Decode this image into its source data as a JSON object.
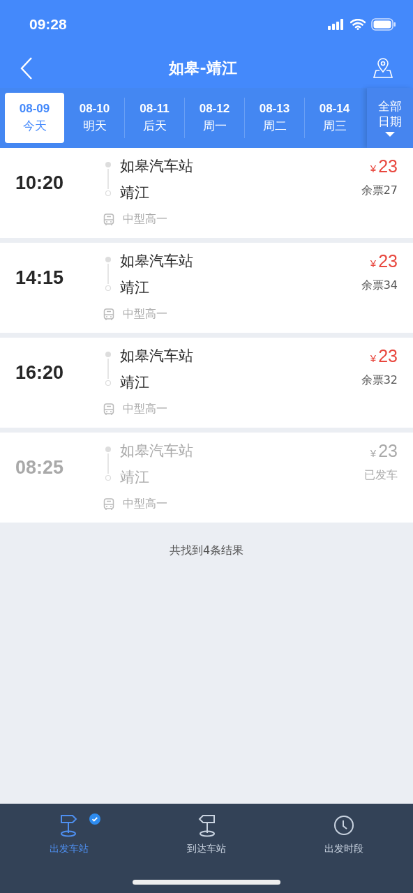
{
  "status_bar": {
    "time": "09:28"
  },
  "nav": {
    "title": "如皋-靖江"
  },
  "date_tabs": [
    {
      "date": "08-09",
      "day": "今天",
      "selected": true
    },
    {
      "date": "08-10",
      "day": "明天",
      "selected": false
    },
    {
      "date": "08-11",
      "day": "后天",
      "selected": false
    },
    {
      "date": "08-12",
      "day": "周一",
      "selected": false
    },
    {
      "date": "08-13",
      "day": "周二",
      "selected": false
    },
    {
      "date": "08-14",
      "day": "周三",
      "selected": false
    }
  ],
  "all_dates": {
    "line1": "全部",
    "line2": "日期"
  },
  "trips": [
    {
      "time": "10:20",
      "from": "如皋汽车站",
      "to": "靖江",
      "bus": "中型高一",
      "currency": "¥",
      "price": "23",
      "seats": "余票27",
      "departed": false
    },
    {
      "time": "14:15",
      "from": "如皋汽车站",
      "to": "靖江",
      "bus": "中型高一",
      "currency": "¥",
      "price": "23",
      "seats": "余票34",
      "departed": false
    },
    {
      "time": "16:20",
      "from": "如皋汽车站",
      "to": "靖江",
      "bus": "中型高一",
      "currency": "¥",
      "price": "23",
      "seats": "余票32",
      "departed": false
    },
    {
      "time": "08:25",
      "from": "如皋汽车站",
      "to": "靖江",
      "bus": "中型高一",
      "currency": "¥",
      "price": "23",
      "seats": "已发车",
      "departed": true
    }
  ],
  "result_count": "共找到4条结果",
  "bottom_tabs": [
    {
      "label": "出发车站",
      "kind": "departure",
      "selected": true,
      "checked": true
    },
    {
      "label": "到达车站",
      "kind": "arrival",
      "selected": false,
      "checked": false
    },
    {
      "label": "出发时段",
      "kind": "time",
      "selected": false,
      "checked": false
    }
  ]
}
